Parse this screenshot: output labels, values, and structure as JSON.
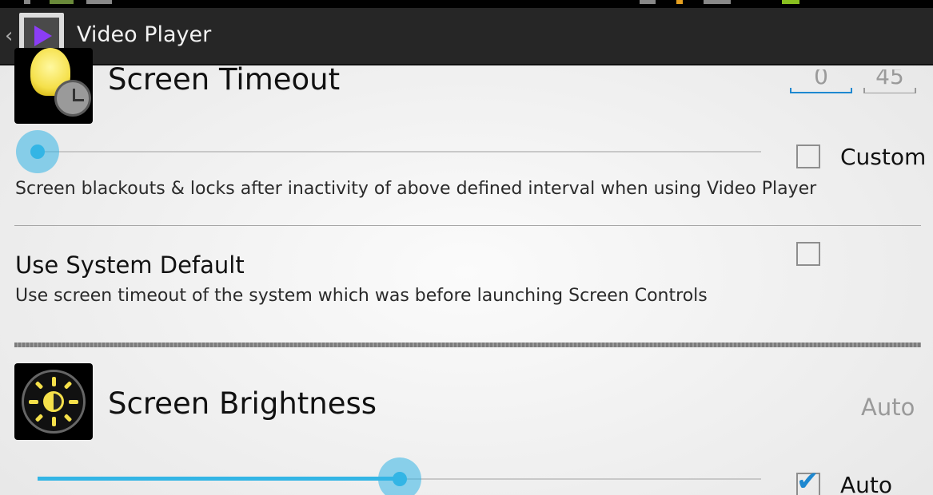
{
  "action_bar": {
    "title": "Video Player"
  },
  "timeout": {
    "title": "Screen Timeout",
    "minutes": "0",
    "seconds": "45",
    "slider_fraction": 0.0,
    "custom_label": "Custom",
    "custom_checked": false,
    "summary": "Screen blackouts & locks after inactivity of above defined interval when using Video Player"
  },
  "system_default": {
    "title": "Use System Default",
    "summary": "Use screen timeout of the system which was before launching Screen Controls",
    "checked": false
  },
  "brightness": {
    "title": "Screen Brightness",
    "value": "Auto",
    "slider_fraction": 0.5,
    "auto_label": "Auto",
    "auto_checked": true
  },
  "colors": {
    "accent": "#33b5e5",
    "action_bar": "#262626"
  }
}
